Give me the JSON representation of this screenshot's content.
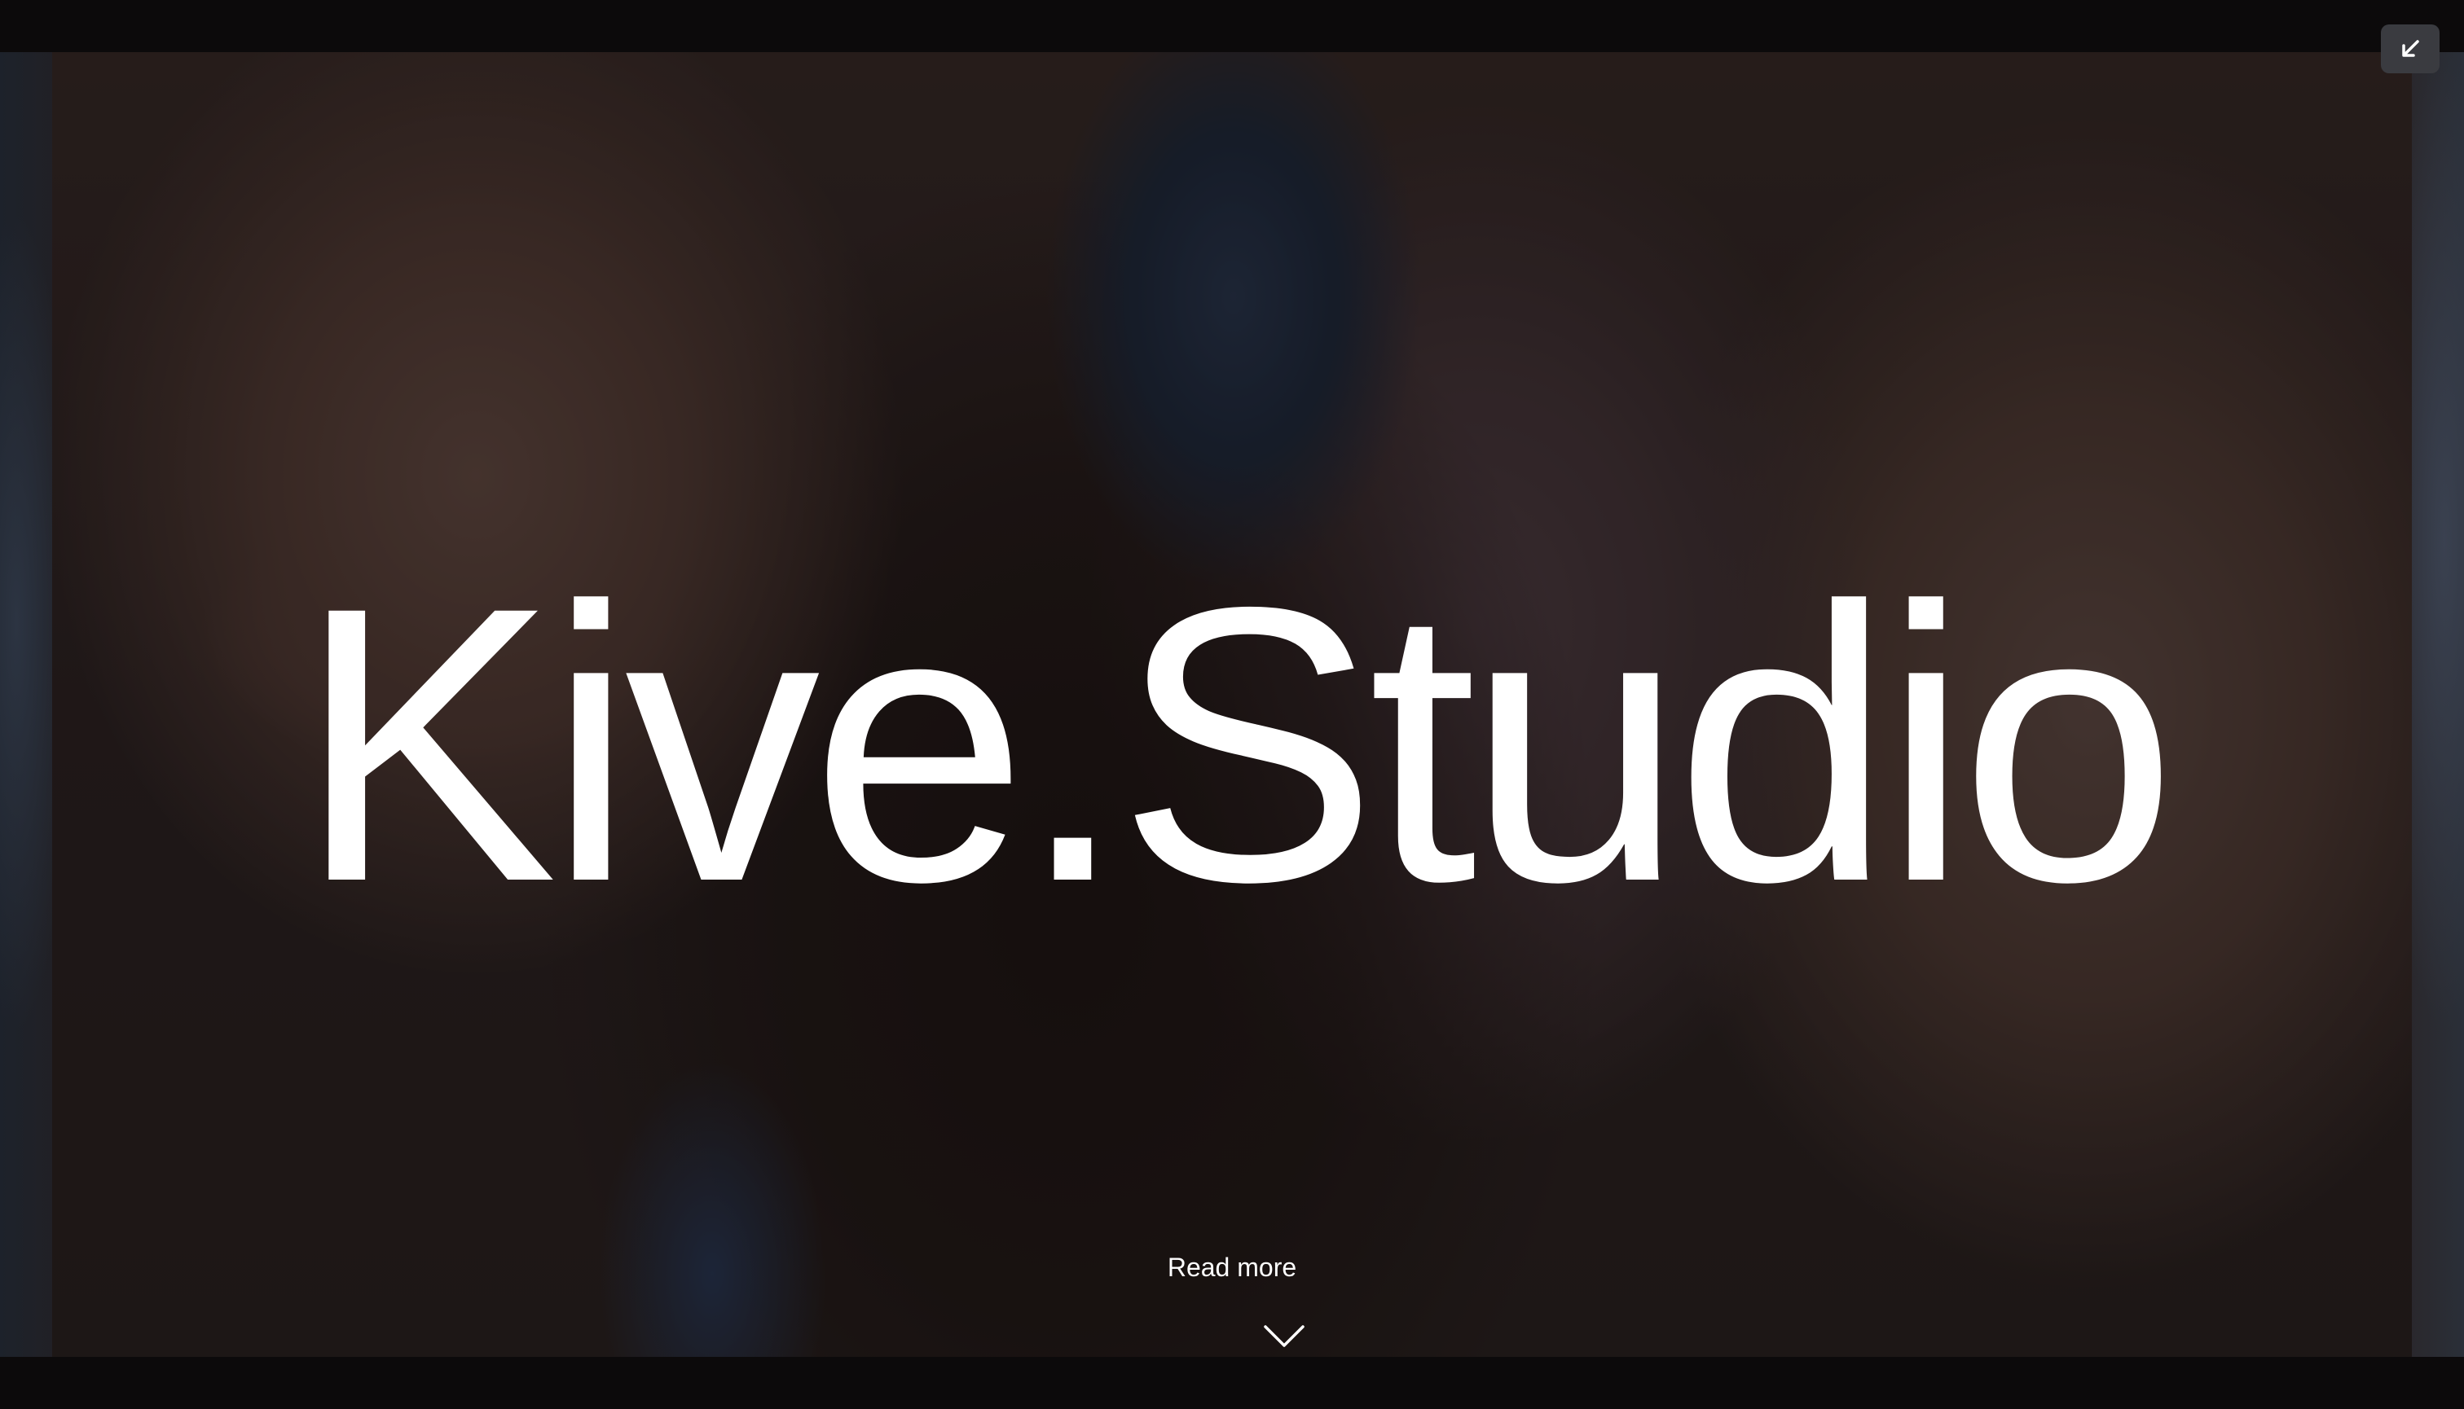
{
  "hero": {
    "title": "Kive.Studio",
    "read_more_label": "Read more"
  },
  "controls": {
    "exit_fullscreen_icon": "arrow-down-left-icon",
    "scroll_icon": "chevron-down-icon"
  },
  "colors": {
    "frame": "#0b090a",
    "text": "#ffffff",
    "button_bg": "#3a3b40"
  }
}
